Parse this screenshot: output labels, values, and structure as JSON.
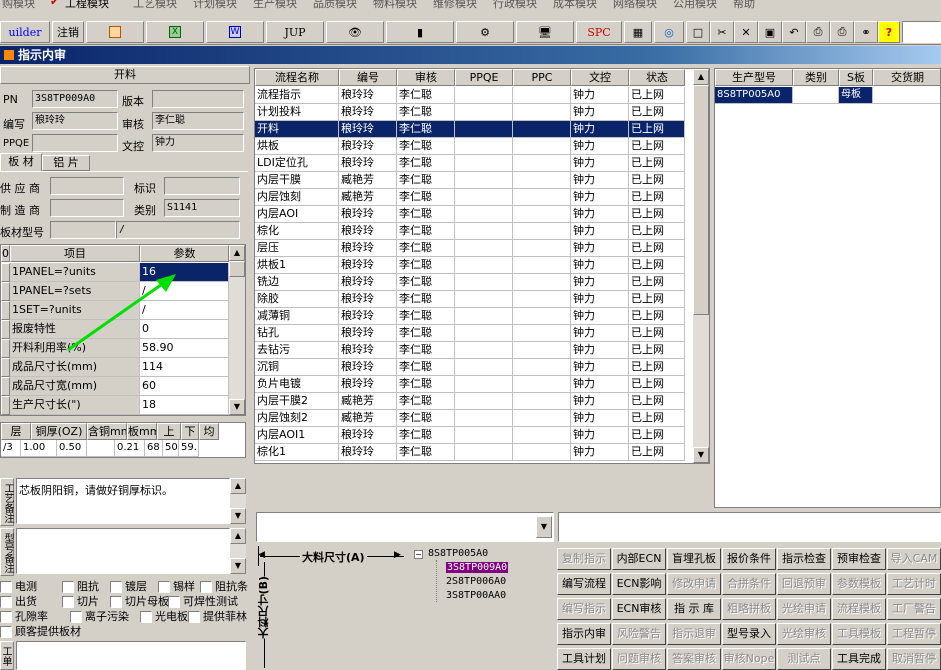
{
  "menu": {
    "items": [
      "购模块",
      "工程模块",
      "工艺模块",
      "计划模块",
      "生产模块",
      "品质模块",
      "物料模块",
      "维修模块",
      "行政模块",
      "成本模块",
      "网络模块",
      "公用模块",
      "帮助"
    ]
  },
  "toolbar": {
    "builder": "uilder",
    "logout": "注销",
    "jup": "JUP",
    "spc": "SPC"
  },
  "window": {
    "title": "指示内审"
  },
  "left": {
    "section_title": "开料",
    "pn_label": "PN",
    "pn_value": "3S8TP009A0",
    "version_label": "版本",
    "version_value": "",
    "author_label": "编写",
    "author_value": "稂玲玲",
    "review_label": "审核",
    "review_value": "李仁聪",
    "ppqe_label": "PPQE",
    "ppqe_value": "",
    "control_label": "文控",
    "control_value": "钟力",
    "tabs": [
      "板 材",
      "铝 片"
    ],
    "supplier_label": "供 应 商",
    "supplier_value": "",
    "mark_label": "标识",
    "mark_value": "",
    "maker_label": "制 造 商",
    "maker_value": "",
    "category_label": "类别",
    "category_value": "S1141",
    "model_label": "板材型号",
    "model_value": "",
    "model_value2": "/",
    "param_header": [
      "0",
      "项目",
      "参数"
    ],
    "params": [
      {
        "item": "1PANEL=?units",
        "value": "16"
      },
      {
        "item": "1PANEL=?sets",
        "value": "/"
      },
      {
        "item": "1SET=?units",
        "value": "/"
      },
      {
        "item": "报废特性",
        "value": "0"
      },
      {
        "item": "开料利用率(%)",
        "value": "58.90"
      },
      {
        "item": "成品尺寸长(mm)",
        "value": "114"
      },
      {
        "item": "成品尺寸宽(mm)",
        "value": "60"
      },
      {
        "item": "生产尺寸长(\")",
        "value": "18"
      }
    ],
    "layer_header": [
      "层",
      "铜厚(OZ)",
      "含铜mm",
      "板mm",
      "上",
      "下",
      "均"
    ],
    "layer_row": [
      "/3",
      "1.00",
      "0.50",
      "",
      "0.21",
      "68",
      "50",
      "59."
    ],
    "remark_label": "工艺备注",
    "remark_text": "芯板阴阳铜，请做好铜厚标识。",
    "remark2_label": "型号备注",
    "checks": [
      [
        "电测",
        "阻抗",
        "镀层",
        "锡样",
        "阻抗条"
      ],
      [
        "出货",
        "切片",
        "切片母板",
        "可焊性测试"
      ],
      [
        "孔隙率",
        "离子污染",
        "光电板",
        "提供菲林"
      ],
      [
        "顾客提供板材"
      ]
    ],
    "bottom_label": "工单"
  },
  "flow": {
    "columns": [
      "流程名称",
      "编号",
      "审核",
      "PPQE",
      "PPC",
      "文控",
      "状态"
    ],
    "rows": [
      [
        "流程指示",
        "稂玲玲",
        "李仁聪",
        "",
        "",
        "钟力",
        "已上网"
      ],
      [
        "计划投料",
        "稂玲玲",
        "李仁聪",
        "",
        "",
        "钟力",
        "已上网"
      ],
      [
        "开料",
        "稂玲玲",
        "李仁聪",
        "",
        "",
        "钟力",
        "已上网"
      ],
      [
        "烘板",
        "稂玲玲",
        "李仁聪",
        "",
        "",
        "钟力",
        "已上网"
      ],
      [
        "LDI定位孔",
        "稂玲玲",
        "李仁聪",
        "",
        "",
        "钟力",
        "已上网"
      ],
      [
        "内层干膜",
        "臧艳芳",
        "李仁聪",
        "",
        "",
        "钟力",
        "已上网"
      ],
      [
        "内层蚀刻",
        "臧艳芳",
        "李仁聪",
        "",
        "",
        "钟力",
        "已上网"
      ],
      [
        "内层AOI",
        "稂玲玲",
        "李仁聪",
        "",
        "",
        "钟力",
        "已上网"
      ],
      [
        "棕化",
        "稂玲玲",
        "李仁聪",
        "",
        "",
        "钟力",
        "已上网"
      ],
      [
        "层压",
        "稂玲玲",
        "李仁聪",
        "",
        "",
        "钟力",
        "已上网"
      ],
      [
        "烘板1",
        "稂玲玲",
        "李仁聪",
        "",
        "",
        "钟力",
        "已上网"
      ],
      [
        "铣边",
        "稂玲玲",
        "李仁聪",
        "",
        "",
        "钟力",
        "已上网"
      ],
      [
        "除胶",
        "稂玲玲",
        "李仁聪",
        "",
        "",
        "钟力",
        "已上网"
      ],
      [
        "减薄铜",
        "稂玲玲",
        "李仁聪",
        "",
        "",
        "钟力",
        "已上网"
      ],
      [
        "钻孔",
        "稂玲玲",
        "李仁聪",
        "",
        "",
        "钟力",
        "已上网"
      ],
      [
        "去钻污",
        "稂玲玲",
        "李仁聪",
        "",
        "",
        "钟力",
        "已上网"
      ],
      [
        "沉铜",
        "稂玲玲",
        "李仁聪",
        "",
        "",
        "钟力",
        "已上网"
      ],
      [
        "负片电镀",
        "稂玲玲",
        "李仁聪",
        "",
        "",
        "钟力",
        "已上网"
      ],
      [
        "内层干膜2",
        "臧艳芳",
        "李仁聪",
        "",
        "",
        "钟力",
        "已上网"
      ],
      [
        "内层蚀刻2",
        "臧艳芳",
        "李仁聪",
        "",
        "",
        "钟力",
        "已上网"
      ],
      [
        "内层AOI1",
        "稂玲玲",
        "李仁聪",
        "",
        "",
        "钟力",
        "已上网"
      ],
      [
        "棕化1",
        "稂玲玲",
        "李仁聪",
        "",
        "",
        "钟力",
        "已上网"
      ]
    ],
    "selected": 2
  },
  "prod": {
    "columns": [
      "生产型号",
      "类别",
      "S板",
      "交货期"
    ],
    "rows": [
      [
        "8S8TP005A0",
        "",
        "母板",
        ""
      ]
    ]
  },
  "size": {
    "label_a": "大料尺寸(A)",
    "label_b": "大料尺寸(B)"
  },
  "tree": {
    "root": "8S8TP005A0",
    "children": [
      "3S8TP009A0",
      "2S8TP006A0",
      "3S8TP00AA0"
    ]
  },
  "buttons": [
    [
      {
        "t": "复制指示",
        "d": true
      },
      {
        "t": "内部ECN",
        "d": false
      },
      {
        "t": "盲埋孔板",
        "d": false
      },
      {
        "t": "报价条件",
        "d": false
      },
      {
        "t": "指示检查",
        "d": false
      },
      {
        "t": "预审检查",
        "d": false
      },
      {
        "t": "导入CAM",
        "d": true
      }
    ],
    [
      {
        "t": "编写流程",
        "d": false
      },
      {
        "t": "ECN影响",
        "d": false
      },
      {
        "t": "修改申请",
        "d": true
      },
      {
        "t": "合拼条件",
        "d": true
      },
      {
        "t": "回退预审",
        "d": true
      },
      {
        "t": "参数模板",
        "d": true
      },
      {
        "t": "工艺计时",
        "d": true
      }
    ],
    [
      {
        "t": "编写指示",
        "d": true
      },
      {
        "t": "ECN审核",
        "d": false
      },
      {
        "t": "指 示 库",
        "d": false
      },
      {
        "t": "粗略拼板",
        "d": true
      },
      {
        "t": "光绘申请",
        "d": true
      },
      {
        "t": "流程模板",
        "d": true
      },
      {
        "t": "工厂警告",
        "d": true
      }
    ],
    [
      {
        "t": "指示内审",
        "d": false
      },
      {
        "t": "风险警告",
        "d": true
      },
      {
        "t": "指示退审",
        "d": true
      },
      {
        "t": "型号录入",
        "d": false
      },
      {
        "t": "光绘审核",
        "d": true
      },
      {
        "t": "工具模板",
        "d": true
      },
      {
        "t": "工程暂停",
        "d": true
      }
    ],
    [
      {
        "t": "工具计划",
        "d": false
      },
      {
        "t": "问题审核",
        "d": true
      },
      {
        "t": "答案审核",
        "d": true
      },
      {
        "t": "审核Nope",
        "d": true
      },
      {
        "t": "测试点",
        "d": true
      },
      {
        "t": "工具完成",
        "d": false
      },
      {
        "t": "取消暂停",
        "d": true
      }
    ]
  ],
  "colors": {
    "selection": "#0a246a",
    "title": "#0a246a",
    "arrow": "#00e000",
    "tree_highlight": "#800080"
  }
}
